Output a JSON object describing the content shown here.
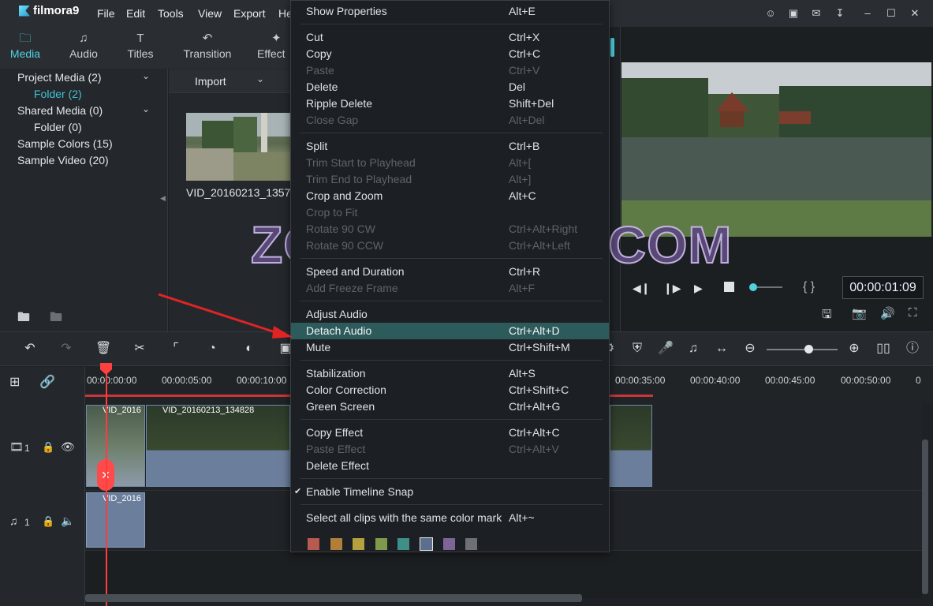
{
  "app": {
    "name": "filmora9"
  },
  "menubar": [
    "File",
    "Edit",
    "Tools",
    "View",
    "Export",
    "He"
  ],
  "tabs": [
    {
      "label": "Media",
      "icon": "folder-icon",
      "active": true
    },
    {
      "label": "Audio",
      "icon": "music-note-icon"
    },
    {
      "label": "Titles",
      "icon": "text-icon"
    },
    {
      "label": "Transition",
      "icon": "transition-icon"
    },
    {
      "label": "Effect",
      "icon": "effect-icon"
    }
  ],
  "library": [
    {
      "label": "Project Media (2)",
      "expand": true
    },
    {
      "label": "Folder (2)",
      "selected": true
    },
    {
      "label": "Shared Media (0)",
      "expand": true
    },
    {
      "label": "Folder (0)"
    },
    {
      "label": "Sample Colors (15)"
    },
    {
      "label": "Sample Video (20)"
    }
  ],
  "media": {
    "import_label": "Import",
    "clip_name": "VID_20160213_1357"
  },
  "preview": {
    "timecode": "00:00:01:09",
    "braces": "{ }"
  },
  "ruler_labels": [
    "00:00:00:00",
    "00:00:05:00",
    "00:00:10:00",
    "00:00:35:00",
    "00:00:40:00",
    "00:00:45:00",
    "00:00:50:00",
    "0"
  ],
  "tracks": {
    "video_label": "1",
    "audio_label": "1",
    "clip1": "VID_2016",
    "clip2": "VID_20160213_134828",
    "audio_clip": "VID_2016"
  },
  "context_menu": [
    {
      "label": "Show Properties",
      "shortcut": "Alt+E",
      "enabled": true
    },
    {
      "sep": true
    },
    {
      "label": "Cut",
      "shortcut": "Ctrl+X",
      "enabled": true
    },
    {
      "label": "Copy",
      "shortcut": "Ctrl+C",
      "enabled": true
    },
    {
      "label": "Paste",
      "shortcut": "Ctrl+V",
      "enabled": false
    },
    {
      "label": "Delete",
      "shortcut": "Del",
      "enabled": true
    },
    {
      "label": "Ripple Delete",
      "shortcut": "Shift+Del",
      "enabled": true
    },
    {
      "label": "Close Gap",
      "shortcut": "Alt+Del",
      "enabled": false
    },
    {
      "sep": true
    },
    {
      "label": "Split",
      "shortcut": "Ctrl+B",
      "enabled": true
    },
    {
      "label": "Trim Start to Playhead",
      "shortcut": "Alt+[",
      "enabled": false
    },
    {
      "label": "Trim End to Playhead",
      "shortcut": "Alt+]",
      "enabled": false
    },
    {
      "label": "Crop and Zoom",
      "shortcut": "Alt+C",
      "enabled": true
    },
    {
      "label": "Crop to Fit",
      "shortcut": "",
      "enabled": false
    },
    {
      "label": "Rotate 90 CW",
      "shortcut": "Ctrl+Alt+Right",
      "enabled": false
    },
    {
      "label": "Rotate 90 CCW",
      "shortcut": "Ctrl+Alt+Left",
      "enabled": false
    },
    {
      "sep": true
    },
    {
      "label": "Speed and Duration",
      "shortcut": "Ctrl+R",
      "enabled": true
    },
    {
      "label": "Add Freeze Frame",
      "shortcut": "Alt+F",
      "enabled": false
    },
    {
      "sep": true
    },
    {
      "label": "Adjust Audio",
      "shortcut": "",
      "enabled": true
    },
    {
      "label": "Detach Audio",
      "shortcut": "Ctrl+Alt+D",
      "enabled": true,
      "highlight": true
    },
    {
      "label": "Mute",
      "shortcut": "Ctrl+Shift+M",
      "enabled": true
    },
    {
      "sep": true
    },
    {
      "label": "Stabilization",
      "shortcut": "Alt+S",
      "enabled": true
    },
    {
      "label": "Color Correction",
      "shortcut": "Ctrl+Shift+C",
      "enabled": true
    },
    {
      "label": "Green Screen",
      "shortcut": "Ctrl+Alt+G",
      "enabled": true
    },
    {
      "sep": true
    },
    {
      "label": "Copy Effect",
      "shortcut": "Ctrl+Alt+C",
      "enabled": true
    },
    {
      "label": "Paste Effect",
      "shortcut": "Ctrl+Alt+V",
      "enabled": false
    },
    {
      "label": "Delete Effect",
      "shortcut": "",
      "enabled": true
    },
    {
      "sep": true
    },
    {
      "label": "Enable Timeline Snap",
      "shortcut": "",
      "enabled": true,
      "checked": true
    },
    {
      "sep": true
    },
    {
      "label": "Select all clips with the same color mark",
      "shortcut": "Alt+~",
      "enabled": true
    }
  ],
  "color_marks": [
    "#b85a4f",
    "#b27f3a",
    "#b4a03f",
    "#7f9a4a",
    "#3f8f86",
    "#5b6f8d",
    "#7d659a",
    "#6d7074"
  ],
  "watermark": "ZOTUTORIAL.COM"
}
